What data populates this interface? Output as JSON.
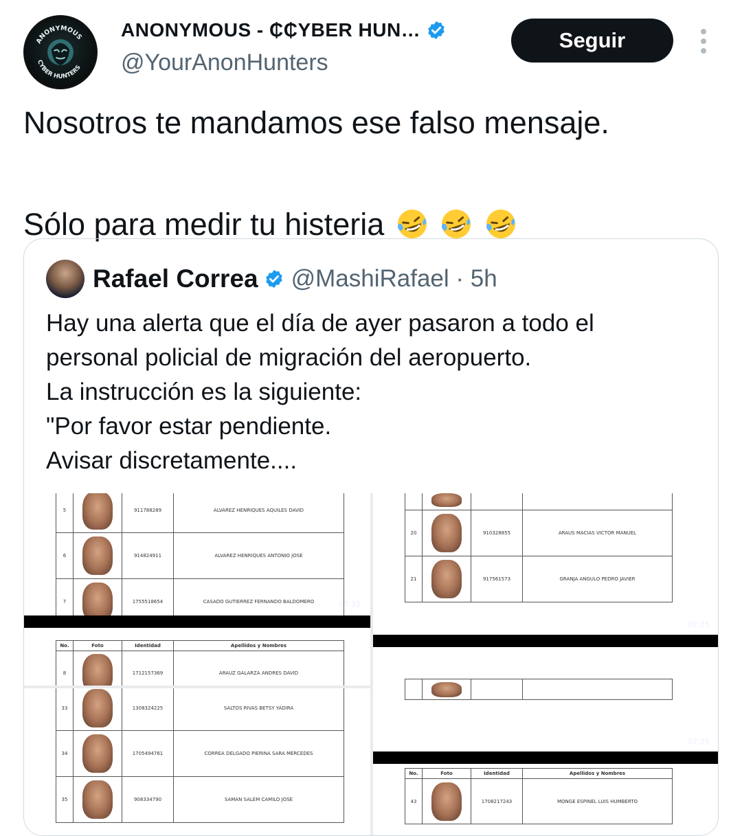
{
  "author": {
    "display_name": "ANONYMOUS - ₵₵YBER HUN…",
    "handle": "@YourAnonHunters",
    "avatar_text_top": "ANONYMOUS",
    "avatar_text_bottom": "CYBER HUNTERS"
  },
  "actions": {
    "follow_label": "Seguir"
  },
  "tweet": {
    "line1": "Nosotros te mandamos ese falso mensaje.",
    "line2": "Sólo para medir tu histeria",
    "emoji": "rolling-on-floor-laughing"
  },
  "quoted": {
    "name": "Rafael Correa",
    "handle_time": "@MashiRafael · 5h",
    "lines": [
      "Hay una alerta que el día de ayer pasaron a todo el",
      "personal policial de migración del aeropuerto.",
      "La instrucción es la siguiente:",
      "\"Por favor estar pendiente.",
      "Avisar discretamente...."
    ]
  },
  "media": {
    "timestamp": "07:35",
    "headers": [
      "No.",
      "Foto",
      "Identidad",
      "Apellidos y Nombres"
    ],
    "panel_a": [
      {
        "no": "5",
        "id": "911788289",
        "name": "ALVAREZ HENRIQUES AQUILES DAVID"
      },
      {
        "no": "6",
        "id": "914824911",
        "name": "ALVAREZ HENRIQUES ANTONIO JOSE"
      },
      {
        "no": "7",
        "id": "1755518654",
        "name": "CASADO GUTIERREZ FERNANDO BALDOMERO"
      }
    ],
    "panel_b": [
      {
        "no": "20",
        "id": "910328855",
        "name": "ARAUS MACIAS VICTOR MANUEL"
      },
      {
        "no": "21",
        "id": "917561573",
        "name": "GRANJA ANGULO PEDRO JAVIER"
      }
    ],
    "panel_c": [
      {
        "no": "8",
        "id": "1712157369",
        "name": "ARAUZ GALARZA ANDRES DAVID"
      }
    ],
    "panel_d": [
      {
        "no": "33",
        "id": "1308324225",
        "name": "SALTOS RIVAS BETSY YADIRA"
      },
      {
        "no": "34",
        "id": "1705494761",
        "name": "CORREA DELGADO PIERINA SARA MERCEDES"
      },
      {
        "no": "35",
        "id": "908334790",
        "name": "SAMAN SALEM CAMILO JOSE"
      }
    ],
    "panel_f": [
      {
        "no": "43",
        "id": "1708217243",
        "name": "MONGE ESPINEL LUIS HUMBERTO"
      }
    ]
  }
}
